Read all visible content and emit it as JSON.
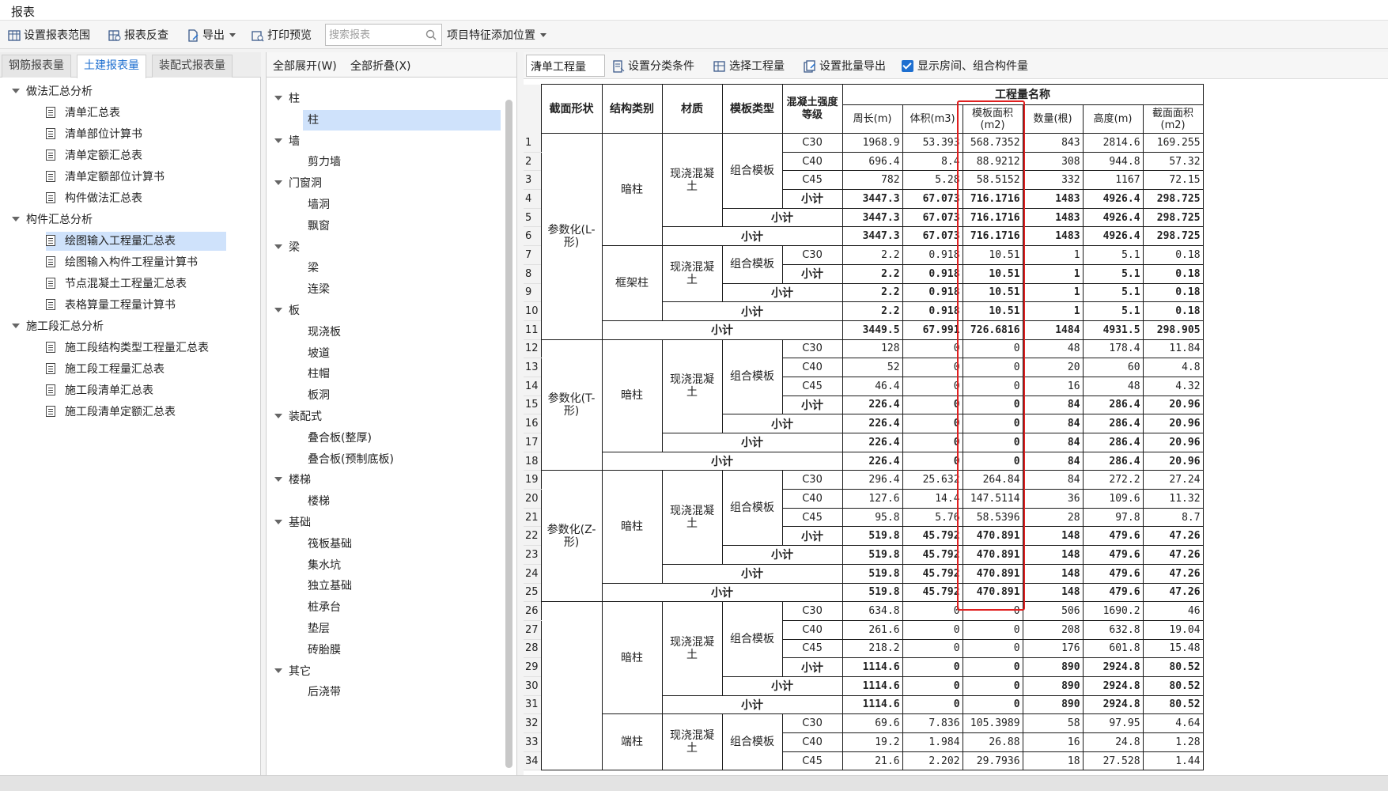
{
  "window": {
    "title": "报表"
  },
  "toolbar": {
    "set_range": "设置报表范围",
    "report_check": "报表反查",
    "export": "导出",
    "print_preview": "打印预览",
    "search_placeholder": "搜索报表",
    "feature_position": "项目特征添加位置"
  },
  "left_tabs": [
    "钢筋报表量",
    "土建报表量",
    "装配式报表量"
  ],
  "left_tree": [
    {
      "label": "做法汇总分析",
      "level": 0
    },
    {
      "label": "清单汇总表",
      "level": 1
    },
    {
      "label": "清单部位计算书",
      "level": 1
    },
    {
      "label": "清单定额汇总表",
      "level": 1
    },
    {
      "label": "清单定额部位计算书",
      "level": 1
    },
    {
      "label": "构件做法汇总表",
      "level": 1
    },
    {
      "label": "构件汇总分析",
      "level": 0
    },
    {
      "label": "绘图输入工程量汇总表",
      "level": 1,
      "selected": true
    },
    {
      "label": "绘图输入构件工程量计算书",
      "level": 1
    },
    {
      "label": "节点混凝土工程量汇总表",
      "level": 1
    },
    {
      "label": "表格算量工程量计算书",
      "level": 1
    },
    {
      "label": "施工段汇总分析",
      "level": 0
    },
    {
      "label": "施工段结构类型工程量汇总表",
      "level": 1
    },
    {
      "label": "施工段工程量汇总表",
      "level": 1
    },
    {
      "label": "施工段清单汇总表",
      "level": 1
    },
    {
      "label": "施工段清单定额汇总表",
      "level": 1
    }
  ],
  "middle": {
    "expand_all": "全部展开(W)",
    "collapse_all": "全部折叠(X)",
    "tree": [
      {
        "label": "柱",
        "level": 0
      },
      {
        "label": "柱",
        "level": 1,
        "selected": true
      },
      {
        "label": "墙",
        "level": 0
      },
      {
        "label": "剪力墙",
        "level": 1
      },
      {
        "label": "门窗洞",
        "level": 0
      },
      {
        "label": "墙洞",
        "level": 1
      },
      {
        "label": "飘窗",
        "level": 1
      },
      {
        "label": "梁",
        "level": 0
      },
      {
        "label": "梁",
        "level": 1
      },
      {
        "label": "连梁",
        "level": 1
      },
      {
        "label": "板",
        "level": 0
      },
      {
        "label": "现浇板",
        "level": 1
      },
      {
        "label": "坡道",
        "level": 1
      },
      {
        "label": "柱帽",
        "level": 1
      },
      {
        "label": "板洞",
        "level": 1
      },
      {
        "label": "装配式",
        "level": 0
      },
      {
        "label": "叠合板(整厚)",
        "level": 1
      },
      {
        "label": "叠合板(预制底板)",
        "level": 1
      },
      {
        "label": "楼梯",
        "level": 0
      },
      {
        "label": "楼梯",
        "level": 1
      },
      {
        "label": "基础",
        "level": 0
      },
      {
        "label": "筏板基础",
        "level": 1
      },
      {
        "label": "集水坑",
        "level": 1
      },
      {
        "label": "独立基础",
        "level": 1
      },
      {
        "label": "桩承台",
        "level": 1
      },
      {
        "label": "垫层",
        "level": 1
      },
      {
        "label": "砖胎膜",
        "level": 1
      },
      {
        "label": "其它",
        "level": 0
      },
      {
        "label": "后浇带",
        "level": 1
      }
    ]
  },
  "right_toolbar": {
    "combo_value": "清单工程量",
    "set_category": "设置分类条件",
    "select_quantity": "选择工程量",
    "batch_export": "设置批量导出",
    "show_rooms": "显示房间、组合构件量"
  },
  "table": {
    "group_header": "工程量名称",
    "headers": [
      "截面形状",
      "结构类别",
      "材质",
      "模板类型",
      "混凝土强度等级",
      "周长(m)",
      "体积(m3)",
      "模板面积(m2)",
      "数量(根)",
      "高度(m)",
      "截面面积(m2)"
    ],
    "subtotal": "小计",
    "groups": {
      "g1_shape": "参数化(L-形)",
      "g2_shape": "参数化(T-形)",
      "g3_shape": "参数化(Z-形)",
      "dark_column": "暗柱",
      "frame_column": "框架柱",
      "end_column": "端柱",
      "material": "现浇混凝土",
      "formwork": "组合模板"
    },
    "rows": [
      {
        "rn": "1",
        "grade": "C30",
        "v": [
          "1968.9",
          "53.393",
          "568.7352",
          "843",
          "2814.6",
          "169.255"
        ]
      },
      {
        "rn": "2",
        "grade": "C40",
        "v": [
          "696.4",
          "8.4",
          "88.9212",
          "308",
          "944.8",
          "57.32"
        ]
      },
      {
        "rn": "3",
        "grade": "C45",
        "v": [
          "782",
          "5.28",
          "58.5152",
          "332",
          "1167",
          "72.15"
        ]
      },
      {
        "rn": "4",
        "v": [
          "3447.3",
          "67.073",
          "716.1716",
          "1483",
          "4926.4",
          "298.725"
        ]
      },
      {
        "rn": "5",
        "v": [
          "3447.3",
          "67.073",
          "716.1716",
          "1483",
          "4926.4",
          "298.725"
        ]
      },
      {
        "rn": "6",
        "v": [
          "3447.3",
          "67.073",
          "716.1716",
          "1483",
          "4926.4",
          "298.725"
        ]
      },
      {
        "rn": "7",
        "grade": "C30",
        "v": [
          "2.2",
          "0.918",
          "10.51",
          "1",
          "5.1",
          "0.18"
        ]
      },
      {
        "rn": "8",
        "v": [
          "2.2",
          "0.918",
          "10.51",
          "1",
          "5.1",
          "0.18"
        ]
      },
      {
        "rn": "9",
        "v": [
          "2.2",
          "0.918",
          "10.51",
          "1",
          "5.1",
          "0.18"
        ]
      },
      {
        "rn": "10",
        "v": [
          "2.2",
          "0.918",
          "10.51",
          "1",
          "5.1",
          "0.18"
        ]
      },
      {
        "rn": "11",
        "v": [
          "3449.5",
          "67.991",
          "726.6816",
          "1484",
          "4931.5",
          "298.905"
        ]
      },
      {
        "rn": "12",
        "grade": "C30",
        "v": [
          "128",
          "0",
          "0",
          "48",
          "178.4",
          "11.84"
        ]
      },
      {
        "rn": "13",
        "grade": "C40",
        "v": [
          "52",
          "0",
          "0",
          "20",
          "60",
          "4.8"
        ]
      },
      {
        "rn": "14",
        "grade": "C45",
        "v": [
          "46.4",
          "0",
          "0",
          "16",
          "48",
          "4.32"
        ]
      },
      {
        "rn": "15",
        "v": [
          "226.4",
          "0",
          "0",
          "84",
          "286.4",
          "20.96"
        ]
      },
      {
        "rn": "16",
        "v": [
          "226.4",
          "0",
          "0",
          "84",
          "286.4",
          "20.96"
        ]
      },
      {
        "rn": "17",
        "v": [
          "226.4",
          "0",
          "0",
          "84",
          "286.4",
          "20.96"
        ]
      },
      {
        "rn": "18",
        "v": [
          "226.4",
          "0",
          "0",
          "84",
          "286.4",
          "20.96"
        ]
      },
      {
        "rn": "19",
        "grade": "C30",
        "v": [
          "296.4",
          "25.632",
          "264.84",
          "84",
          "272.2",
          "27.24"
        ]
      },
      {
        "rn": "20",
        "grade": "C40",
        "v": [
          "127.6",
          "14.4",
          "147.5114",
          "36",
          "109.6",
          "11.32"
        ]
      },
      {
        "rn": "21",
        "grade": "C45",
        "v": [
          "95.8",
          "5.76",
          "58.5396",
          "28",
          "97.8",
          "8.7"
        ]
      },
      {
        "rn": "22",
        "v": [
          "519.8",
          "45.792",
          "470.891",
          "148",
          "479.6",
          "47.26"
        ]
      },
      {
        "rn": "23",
        "v": [
          "519.8",
          "45.792",
          "470.891",
          "148",
          "479.6",
          "47.26"
        ]
      },
      {
        "rn": "24",
        "v": [
          "519.8",
          "45.792",
          "470.891",
          "148",
          "479.6",
          "47.26"
        ]
      },
      {
        "rn": "25",
        "v": [
          "519.8",
          "45.792",
          "470.891",
          "148",
          "479.6",
          "47.26"
        ]
      },
      {
        "rn": "26",
        "grade": "C30",
        "v": [
          "634.8",
          "0",
          "0",
          "506",
          "1690.2",
          "46"
        ]
      },
      {
        "rn": "27",
        "grade": "C40",
        "v": [
          "261.6",
          "0",
          "0",
          "208",
          "632.8",
          "19.04"
        ]
      },
      {
        "rn": "28",
        "grade": "C45",
        "v": [
          "218.2",
          "0",
          "0",
          "176",
          "601.8",
          "15.48"
        ]
      },
      {
        "rn": "29",
        "v": [
          "1114.6",
          "0",
          "0",
          "890",
          "2924.8",
          "80.52"
        ]
      },
      {
        "rn": "30",
        "v": [
          "1114.6",
          "0",
          "0",
          "890",
          "2924.8",
          "80.52"
        ]
      },
      {
        "rn": "31",
        "v": [
          "1114.6",
          "0",
          "0",
          "890",
          "2924.8",
          "80.52"
        ]
      },
      {
        "rn": "32",
        "grade": "C30",
        "v": [
          "69.6",
          "7.836",
          "105.3989",
          "58",
          "97.95",
          "4.64"
        ]
      },
      {
        "rn": "33",
        "grade": "C40",
        "v": [
          "19.2",
          "1.984",
          "26.88",
          "16",
          "24.8",
          "1.28"
        ]
      },
      {
        "rn": "34",
        "grade": "C45",
        "v": [
          "21.6",
          "2.202",
          "29.7936",
          "18",
          "27.528",
          "1.44"
        ]
      }
    ]
  }
}
